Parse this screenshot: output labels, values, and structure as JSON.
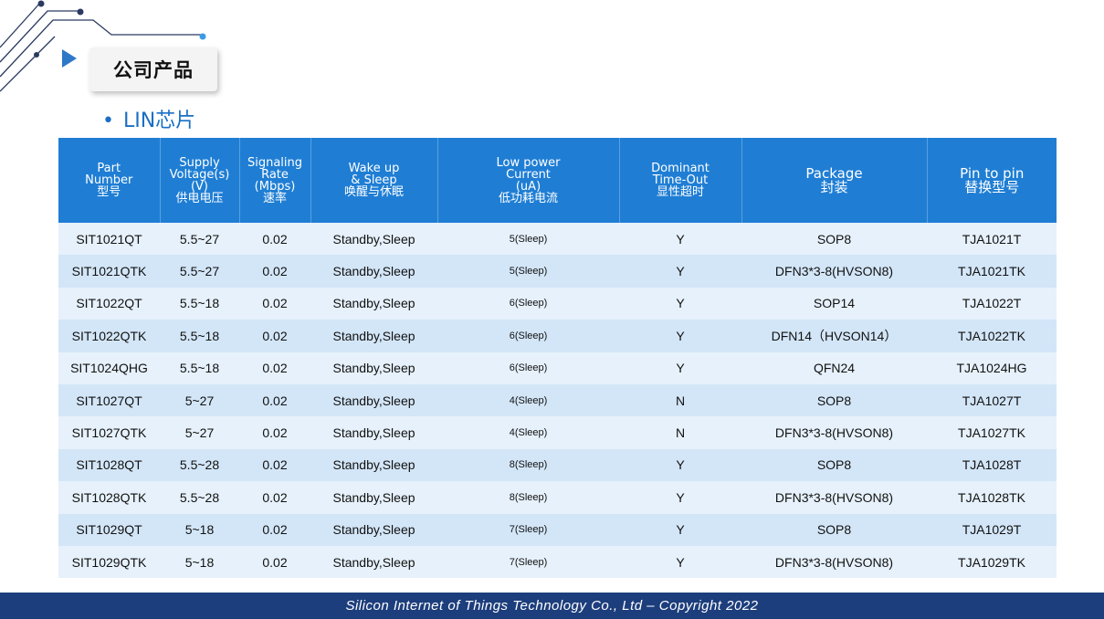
{
  "header": {
    "title": "公司产品",
    "subtitle_bullet": "•",
    "subtitle": "LIN芯片"
  },
  "table": {
    "columns": [
      [
        "Part",
        "Number",
        "型号"
      ],
      [
        "Supply",
        "Voltage(s)",
        "(V)",
        "供电电压"
      ],
      [
        "Signaling",
        "Rate",
        "(Mbps)",
        "速率"
      ],
      [
        "Wake up",
        "& Sleep",
        "唤醒与休眠"
      ],
      [
        "Low power",
        "Current",
        "(uA)",
        "低功耗电流"
      ],
      [
        "Dominant",
        "Time-Out",
        "显性超时"
      ],
      [
        "Package",
        "封装"
      ],
      [
        "Pin to pin",
        "替换型号"
      ]
    ],
    "rows": [
      [
        "SIT1021QT",
        "5.5~27",
        "0.02",
        "Standby,Sleep",
        "5(Sleep)",
        "Y",
        "SOP8",
        "TJA1021T"
      ],
      [
        "SIT1021QTK",
        "5.5~27",
        "0.02",
        "Standby,Sleep",
        "5(Sleep)",
        "Y",
        "DFN3*3-8(HVSON8)",
        "TJA1021TK"
      ],
      [
        "SIT1022QT",
        "5.5~18",
        "0.02",
        "Standby,Sleep",
        "6(Sleep)",
        "Y",
        "SOP14",
        "TJA1022T"
      ],
      [
        "SIT1022QTK",
        "5.5~18",
        "0.02",
        "Standby,Sleep",
        "6(Sleep)",
        "Y",
        "DFN14（HVSON14）",
        "TJA1022TK"
      ],
      [
        "SIT1024QHG",
        "5.5~18",
        "0.02",
        "Standby,Sleep",
        "6(Sleep)",
        "Y",
        "QFN24",
        "TJA1024HG"
      ],
      [
        "SIT1027QT",
        "5~27",
        "0.02",
        "Standby,Sleep",
        "4(Sleep)",
        "N",
        "SOP8",
        "TJA1027T"
      ],
      [
        "SIT1027QTK",
        "5~27",
        "0.02",
        "Standby,Sleep",
        "4(Sleep)",
        "N",
        "DFN3*3-8(HVSON8)",
        "TJA1027TK"
      ],
      [
        "SIT1028QT",
        "5.5~28",
        "0.02",
        "Standby,Sleep",
        "8(Sleep)",
        "Y",
        "SOP8",
        "TJA1028T"
      ],
      [
        "SIT1028QTK",
        "5.5~28",
        "0.02",
        "Standby,Sleep",
        "8(Sleep)",
        "Y",
        "DFN3*3-8(HVSON8)",
        "TJA1028TK"
      ],
      [
        "SIT1029QT",
        "5~18",
        "0.02",
        "Standby,Sleep",
        "7(Sleep)",
        "Y",
        "SOP8",
        "TJA1029T"
      ],
      [
        "SIT1029QTK",
        "5~18",
        "0.02",
        "Standby,Sleep",
        "7(Sleep)",
        "Y",
        "DFN3*3-8(HVSON8)",
        "TJA1029TK"
      ]
    ]
  },
  "footer": {
    "text": "Silicon Internet of Things Technology Co., Ltd  –  Copyright 2022"
  },
  "colors": {
    "header_bg": "#1f7ed4",
    "row_light": "#e6f1fb",
    "row_dark": "#d3e6f8",
    "footer_bg": "#1d3e7c",
    "accent": "#1a6fc4"
  },
  "icons": [
    "circuit-decoration-icon",
    "play-arrow-icon"
  ]
}
